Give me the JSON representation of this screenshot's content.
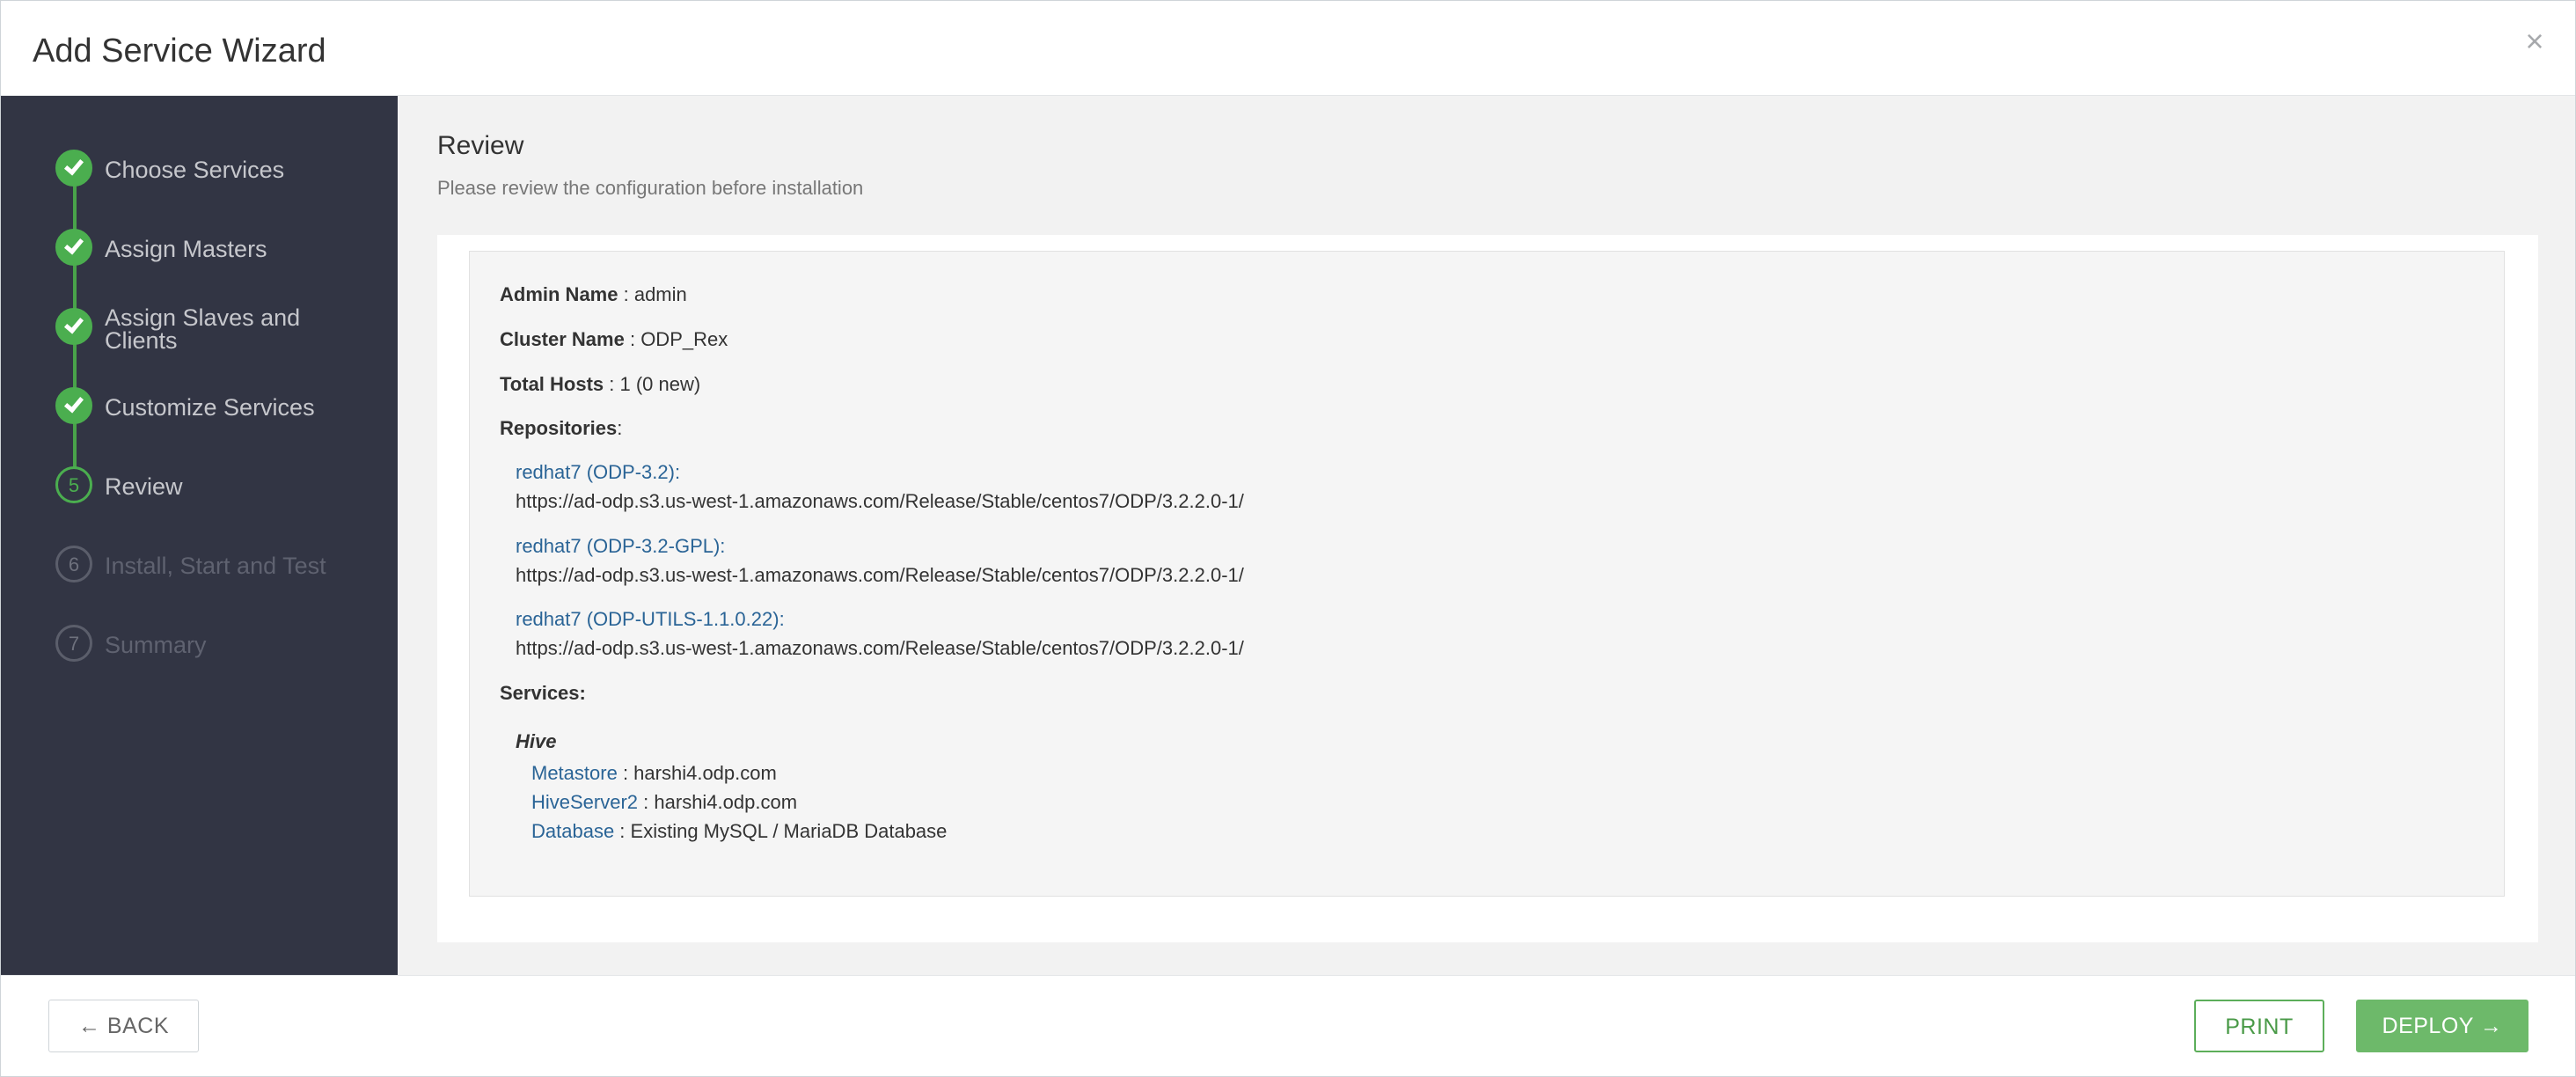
{
  "header": {
    "title": "Add Service Wizard",
    "close_glyph": "×"
  },
  "sidebar": {
    "steps": [
      {
        "number": "1",
        "label": "Choose Services",
        "state": "done"
      },
      {
        "number": "2",
        "label": "Assign Masters",
        "state": "done"
      },
      {
        "number": "3",
        "label": "Assign Slaves and Clients",
        "state": "done"
      },
      {
        "number": "4",
        "label": "Customize Services",
        "state": "done"
      },
      {
        "number": "5",
        "label": "Review",
        "state": "current"
      },
      {
        "number": "6",
        "label": "Install, Start and Test",
        "state": "pending"
      },
      {
        "number": "7",
        "label": "Summary",
        "state": "pending"
      }
    ]
  },
  "main": {
    "title": "Review",
    "subtitle": "Please review the configuration before installation",
    "admin": {
      "label": "Admin Name",
      "value": "admin"
    },
    "cluster": {
      "label": "Cluster Name",
      "value": "ODP_Rex"
    },
    "hosts": {
      "label": "Total Hosts",
      "value": "1 (0 new)"
    },
    "repositories": {
      "label": "Repositories",
      "items": [
        {
          "name": "redhat7 (ODP-3.2):",
          "url": "https://ad-odp.s3.us-west-1.amazonaws.com/Release/Stable/centos7/ODP/3.2.2.0-1/"
        },
        {
          "name": "redhat7 (ODP-3.2-GPL):",
          "url": "https://ad-odp.s3.us-west-1.amazonaws.com/Release/Stable/centos7/ODP/3.2.2.0-1/"
        },
        {
          "name": "redhat7 (ODP-UTILS-1.1.0.22):",
          "url": "https://ad-odp.s3.us-west-1.amazonaws.com/Release/Stable/centos7/ODP/3.2.2.0-1/"
        }
      ]
    },
    "services": {
      "label": "Services:",
      "service_name": "Hive",
      "components": [
        {
          "key": "Metastore",
          "value": "harshi4.odp.com"
        },
        {
          "key": "HiveServer2",
          "value": "harshi4.odp.com"
        },
        {
          "key": "Database",
          "value": "Existing MySQL / MariaDB Database"
        }
      ]
    }
  },
  "footer": {
    "back_label": "← BACK",
    "print_label": "PRINT",
    "deploy_label": "DEPLOY →"
  },
  "colors": {
    "sidebar_bg": "#323544",
    "step_done": "#4bae4f",
    "link_blue": "#2a6496",
    "deploy_bg": "#6db96a"
  }
}
